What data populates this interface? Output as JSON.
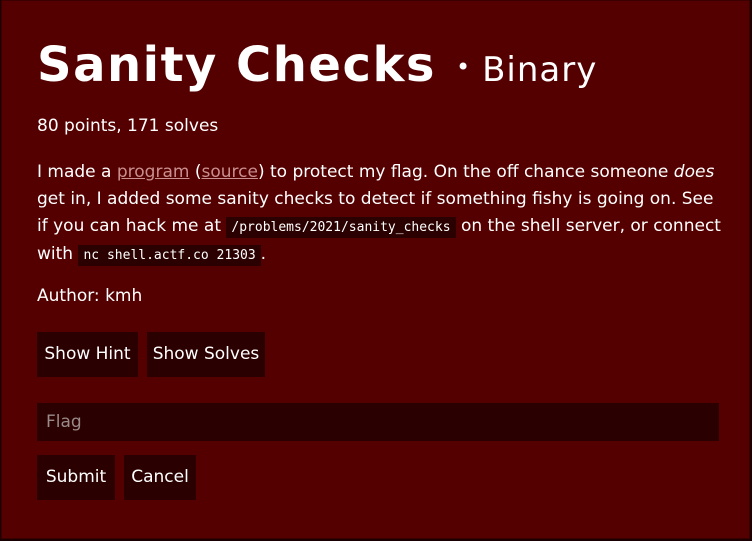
{
  "challenge": {
    "title": "Sanity Checks",
    "bullet": "•",
    "category": "Binary",
    "points_line": "80 points, 171 solves",
    "description": {
      "part1": "I made a ",
      "program_link": "program",
      "paren_open": " (",
      "source_link": "source",
      "part2": ") to protect my flag. On the off chance someone ",
      "emphasis": "does",
      "part3": " get in, I added some sanity checks to detect if something fishy is going on. See if you can hack me at ",
      "path_code": "/problems/2021/sanity_checks",
      "part4": " on the shell server, or connect with ",
      "nc_code": "nc shell.actf.co 21303",
      "part5": "."
    },
    "author": "Author: kmh"
  },
  "buttons": {
    "show_hint": "Show Hint",
    "show_solves": "Show Solves",
    "submit": "Submit",
    "cancel": "Cancel"
  },
  "flag_input": {
    "placeholder": "Flag",
    "value": ""
  },
  "colors": {
    "card_background": "#550000",
    "control_background": "#2a0000",
    "link": "#c98f8f",
    "text": "#ffffff"
  }
}
